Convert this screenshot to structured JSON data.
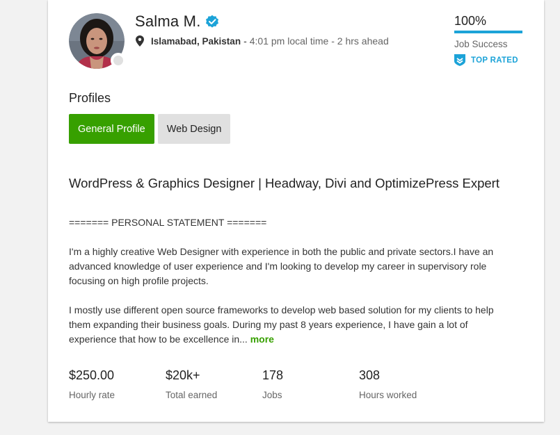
{
  "profile": {
    "name": "Salma M.",
    "city": "Islamabad, Pakistan",
    "separator": "-",
    "local_time": "4:01 pm local time - 2 hrs ahead"
  },
  "job_success": {
    "percent_text": "100%",
    "percent_value": 100,
    "label": "Job Success",
    "badge": "TOP RATED"
  },
  "profiles_section": {
    "title": "Profiles",
    "tabs": [
      {
        "label": "General Profile",
        "active": true
      },
      {
        "label": "Web Design",
        "active": false
      }
    ]
  },
  "overview": {
    "headline": "WordPress & Graphics Designer | Headway, Divi and OptimizePress Expert",
    "statement_header": "======= PERSONAL STATEMENT =======",
    "paragraph1": "I'm a highly creative Web Designer with experience in both the public and private sectors.I have an advanced knowledge of user experience and I'm looking to develop my career in supervisory role focusing on high profile projects.",
    "paragraph2": "I mostly use different open source frameworks to develop web based solution for my clients to help them expanding their business goals. During my past 8 years experience, I have gain a lot of experience that how to be excellence in...",
    "more_label": "more"
  },
  "stats": [
    {
      "value": "$250.00",
      "label": "Hourly rate"
    },
    {
      "value": "$20k+",
      "label": "Total earned"
    },
    {
      "value": "178",
      "label": "Jobs"
    },
    {
      "value": "308",
      "label": "Hours worked"
    }
  ],
  "colors": {
    "accent_green": "#37a000",
    "accent_blue": "#1ca3d8"
  },
  "icons": {
    "verified": "verified-badge-icon",
    "location": "map-pin-icon",
    "top_rated": "shield-icon"
  }
}
